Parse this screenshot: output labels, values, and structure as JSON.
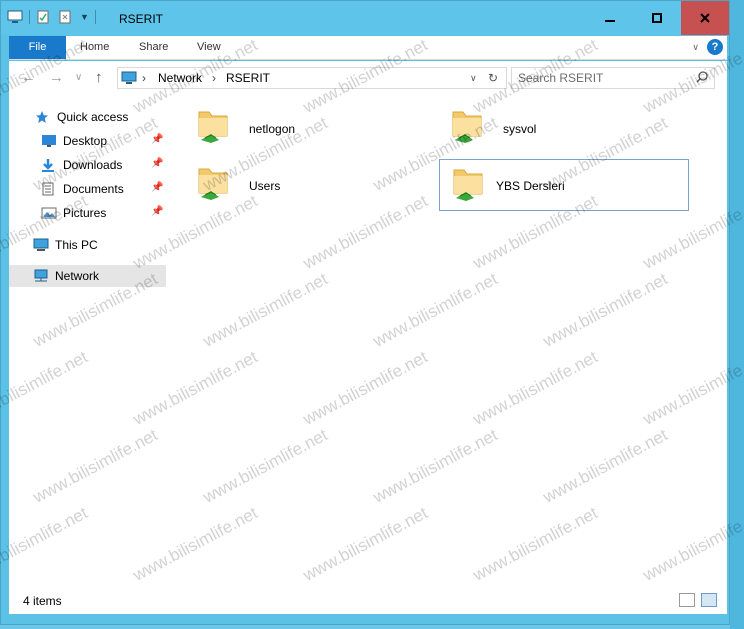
{
  "window": {
    "title": "RSERIT",
    "accent": "#5ec4ea",
    "close_color": "#c75050"
  },
  "ribbon": {
    "tabs": [
      "File",
      "Home",
      "Share",
      "View"
    ],
    "help_label": "?"
  },
  "address": {
    "crumbs": [
      "Network",
      "RSERIT"
    ],
    "search_placeholder": "Search RSERIT"
  },
  "nav": {
    "quick_access": "Quick access",
    "items": [
      "Desktop",
      "Downloads",
      "Documents",
      "Pictures"
    ],
    "this_pc": "This PC",
    "network": "Network"
  },
  "folders": [
    {
      "name": "netlogon",
      "icon": "shared-folder-icon"
    },
    {
      "name": "sysvol",
      "icon": "shared-folder-icon"
    },
    {
      "name": "Users",
      "icon": "shared-folder-icon"
    },
    {
      "name": "YBS Dersleri",
      "icon": "shared-folder-icon",
      "selected": true
    }
  ],
  "status": {
    "count": "4 items"
  },
  "watermark": "www.bilisimlife.net"
}
